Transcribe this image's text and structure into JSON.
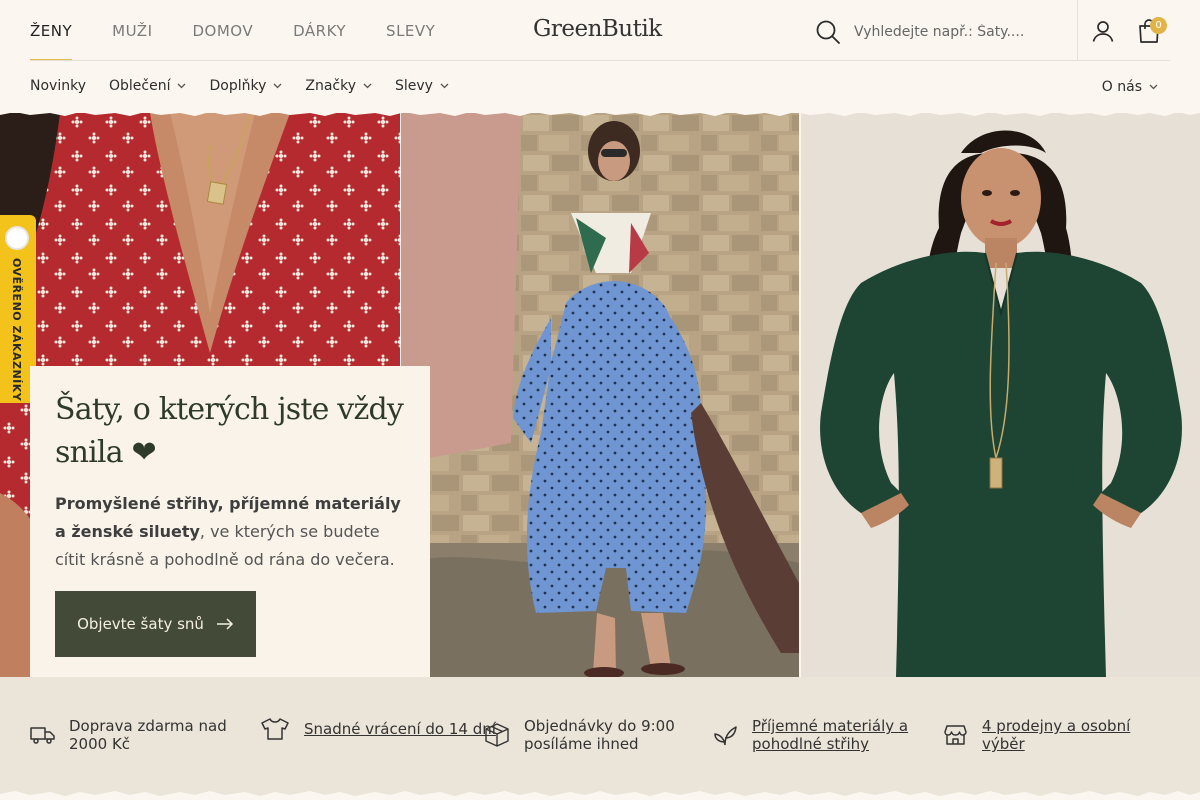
{
  "header": {
    "gender_tabs": [
      {
        "label": "ŽENY",
        "active": true
      },
      {
        "label": "MUŽI",
        "active": false
      },
      {
        "label": "DOMOV",
        "active": false
      },
      {
        "label": "DÁRKY",
        "active": false
      },
      {
        "label": "SLEVY",
        "active": false
      }
    ],
    "brand": "GreenButik",
    "search_placeholder": "Vyhledejte např.: Šaty....",
    "cart_count": "0"
  },
  "subnav": {
    "items": [
      {
        "label": "Novinky",
        "dropdown": false
      },
      {
        "label": "Oblečení",
        "dropdown": true
      },
      {
        "label": "Doplňky",
        "dropdown": true
      },
      {
        "label": "Značky",
        "dropdown": true
      },
      {
        "label": "Slevy",
        "dropdown": true
      }
    ],
    "about": "O nás"
  },
  "hero": {
    "title": "Šaty, o kterých jste vždy snila ❤",
    "text_bold": "Promyšlené střihy, příjemné materiály a ženské siluety",
    "text_rest": ", ve kterých se budete cítit krásně a pohodlně od rána do večera.",
    "cta": "Objevte šaty snů"
  },
  "verified_badge": "OVĚŘENO ZÁKAZNÍKY",
  "usp": [
    {
      "icon": "truck-icon",
      "text": "Doprava zdarma nad 2000 Kč",
      "link": false
    },
    {
      "icon": "tshirt-icon",
      "text": "Snadné vrácení do 14 dní",
      "link": true
    },
    {
      "icon": "box-icon",
      "text": "Objednávky do 9:00 posíláme ihned",
      "link": false
    },
    {
      "icon": "leaf-icon",
      "text": "Příjemné materiály a pohodlné střihy",
      "link": true
    },
    {
      "icon": "store-icon",
      "text": "4 prodejny a osobní výběr",
      "link": true
    }
  ],
  "colors": {
    "background": "#fbf7f0",
    "accent": "#e3b94c",
    "cta": "#434a38",
    "usp_background": "#ebe4d9",
    "badge": "#f3c21b"
  }
}
